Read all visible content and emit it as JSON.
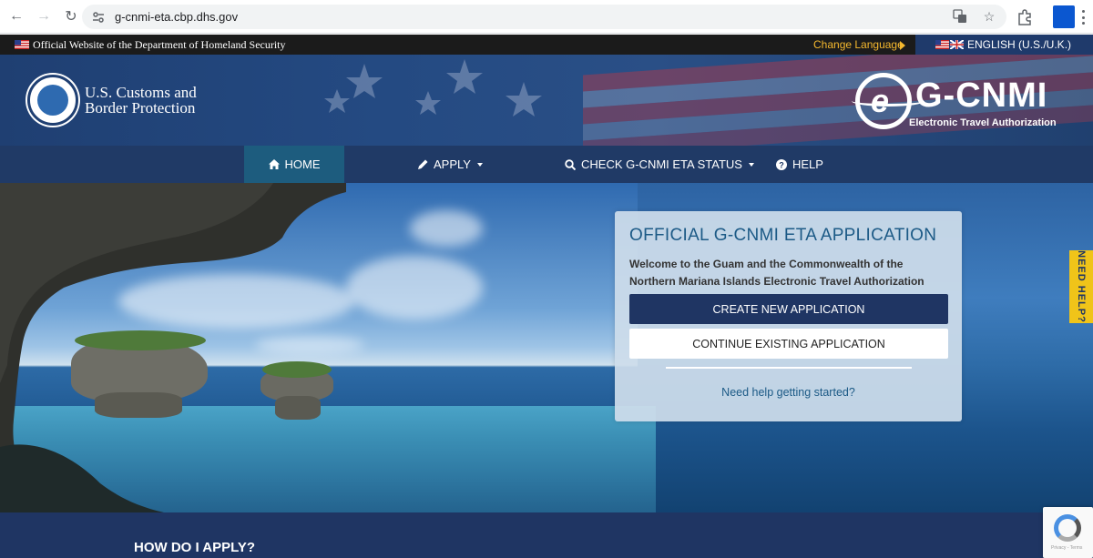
{
  "browser": {
    "url": "g-cnmi-eta.cbp.dhs.gov"
  },
  "gov_banner": {
    "official_text": "Official Website of the Department of Homeland Security",
    "change_language": "Change Language",
    "language": "ENGLISH (U.S./U.K.)"
  },
  "header": {
    "agency_line1": "U.S. Customs and",
    "agency_line2": "Border Protection",
    "brand_title": "G-CNMI",
    "brand_letter": "e",
    "brand_subtitle": "Electronic Travel Authorization"
  },
  "nav": {
    "home": "HOME",
    "apply": "APPLY",
    "status": "CHECK G-CNMI ETA STATUS",
    "help": "HELP"
  },
  "card": {
    "title": "OFFICIAL G-CNMI ETA APPLICATION",
    "welcome": "Welcome to the Guam and the Commonwealth of the Northern Mariana Islands Electronic Travel Authorization",
    "create_button": "CREATE NEW APPLICATION",
    "continue_button": "CONTINUE EXISTING APPLICATION",
    "help_link": "Need help getting started?"
  },
  "need_help_tab": "NEED HELP?",
  "section": {
    "how_to_apply": "HOW DO I APPLY?"
  },
  "recaptcha": {
    "footer": "Privacy - Terms"
  },
  "colors": {
    "nav_bg": "#203a66",
    "nav_active": "#1d5c7e",
    "primary_button": "#1f3563",
    "accent_yellow": "#f0c419",
    "link_blue": "#1c5a86"
  }
}
